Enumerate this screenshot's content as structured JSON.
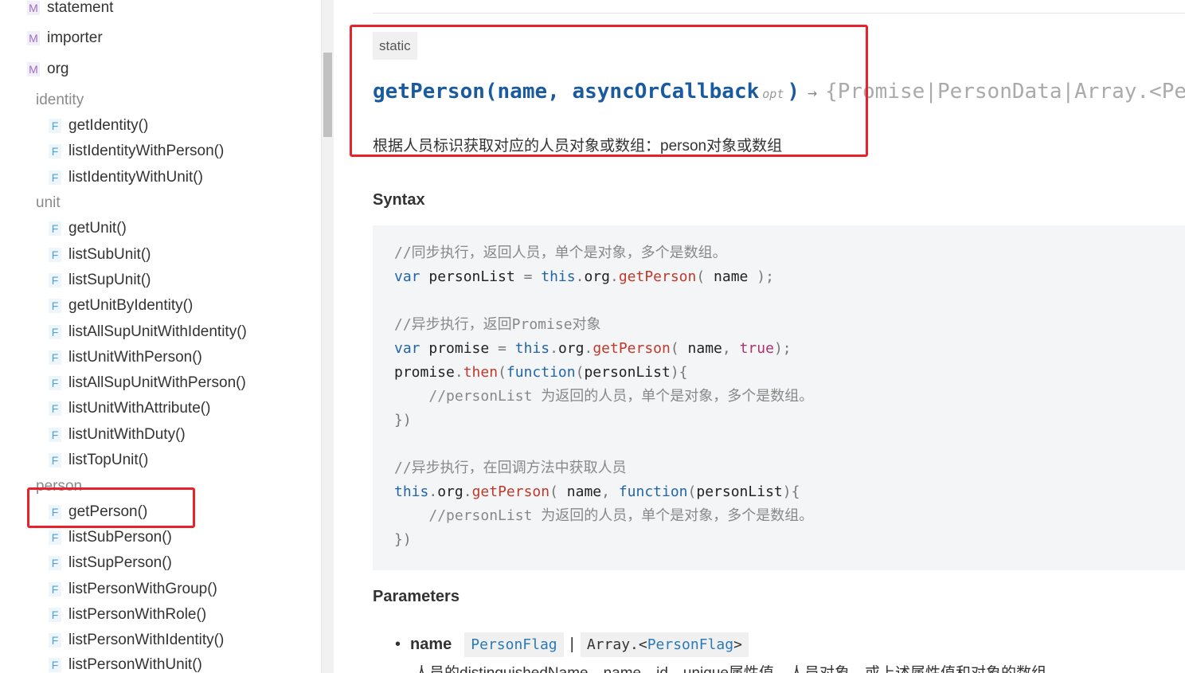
{
  "sidebar": {
    "modules": [
      {
        "badge": "M",
        "label": "statement"
      },
      {
        "badge": "M",
        "label": "importer"
      },
      {
        "badge": "M",
        "label": "org"
      }
    ],
    "groups": {
      "identity": "identity",
      "unit": "unit",
      "person": "person"
    },
    "identity_items": [
      "getIdentity()",
      "listIdentityWithPerson()",
      "listIdentityWithUnit()"
    ],
    "unit_items": [
      "getUnit()",
      "listSubUnit()",
      "listSupUnit()",
      "getUnitByIdentity()",
      "listAllSupUnitWithIdentity()",
      "listUnitWithPerson()",
      "listAllSupUnitWithPerson()",
      "listUnitWithAttribute()",
      "listUnitWithDuty()",
      "listTopUnit()"
    ],
    "person_items": [
      "getPerson()",
      "listSubPerson()",
      "listSupPerson()",
      "listPersonWithGroup()",
      "listPersonWithRole()",
      "listPersonWithIdentity()",
      "listPersonWithUnit()"
    ],
    "function_badge": "F",
    "selected_item": "getPerson()"
  },
  "main": {
    "static_tag": "static",
    "signature": {
      "name": "getPerson(name, asyncOrCallback",
      "opt": "opt",
      "close": ")",
      "arrow": "→",
      "returns": "{Promise|PersonData|Array.<PersonData>}"
    },
    "description": "根据人员标识获取对应的人员对象或数组：person对象或数组",
    "syntax_heading": "Syntax",
    "code": {
      "c1": "//同步执行，返回人员，单个是对象，多个是数组。",
      "c2": "//异步执行，返回Promise对象",
      "c3": "//personList 为返回的人员，单个是对象，多个是数组。",
      "c4": "//异步执行，在回调方法中获取人员",
      "c5": "//personList 为返回的人员，单个是对象，多个是数组。"
    },
    "params_heading": "Parameters",
    "param": {
      "bullet": "•",
      "name": "name",
      "type1": "PersonFlag",
      "separator": "|",
      "type2_prefix": "Array.<",
      "type2_link": "PersonFlag",
      "type2_suffix": ">",
      "description": "人员的distinguishedName、name、id、unique属性值，人员对象，或上述属性值和对象的数组。"
    }
  },
  "colors": {
    "highlight": "#e8222a",
    "signature": "#1a5a9e",
    "keyword": "#2266aa",
    "function": "#c0392b"
  }
}
